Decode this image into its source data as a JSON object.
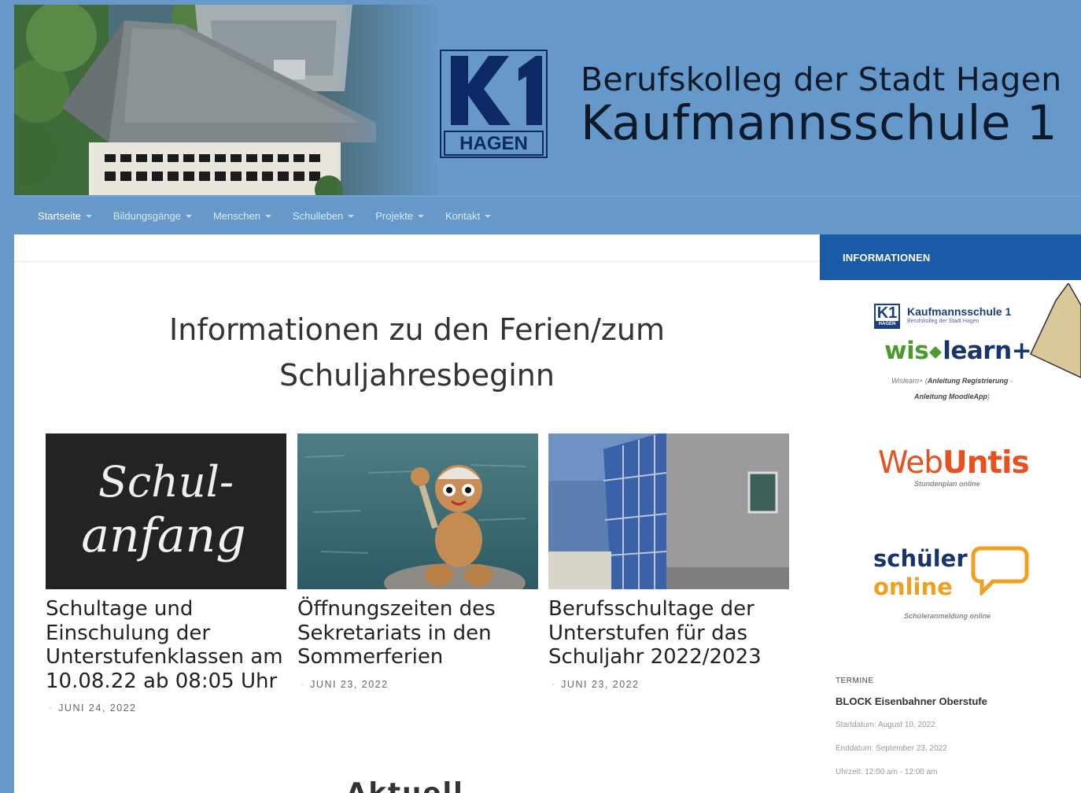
{
  "site": {
    "title_line1": "Berufskolleg der Stadt Hagen",
    "title_line2": "Kaufmannsschule 1",
    "logo_text_top": "K1",
    "logo_text_bottom": "HAGEN"
  },
  "nav": {
    "items": [
      {
        "label": "Startseite"
      },
      {
        "label": "Bildungsgänge"
      },
      {
        "label": "Menschen"
      },
      {
        "label": "Schulleben"
      },
      {
        "label": "Projekte"
      },
      {
        "label": "Kontakt"
      }
    ]
  },
  "main": {
    "section_title": "Informationen zu den Ferien/zum Schuljahresbeginn",
    "posts": [
      {
        "title": "Schultage und Einschulung der Unterstufenklassen am 10.08.22 ab 08:05 Uhr",
        "date": "JUNI 24, 2022",
        "image_text": "Schul-anfang"
      },
      {
        "title": "Öffnungszeiten des Sekretariats in den Sommerferien",
        "date": "JUNI 23, 2022"
      },
      {
        "title": "Berufsschultage der Unterstufen für das Schuljahr 2022/2023",
        "date": "JUNI 23, 2022"
      }
    ],
    "next_section_title": "Aktuell"
  },
  "sidebar": {
    "header": "INFORMATIONEN",
    "k1_name": "Kaufmannsschule 1",
    "k1_sub": "Berufskolleg der Stadt Hagen",
    "k1_box": "K1",
    "k1_box_small": "HAGEN",
    "wislearn_a": "wis",
    "wislearn_b": "learn+",
    "wislearn_note_a": "Wislearn+ (",
    "wislearn_note_b": "Anleitung Registrierung",
    "wislearn_note_c": " - ",
    "wislearn_note_d": "Anleitung MoodleApp",
    "wislearn_note_e": ")",
    "webuntis_a": "Web",
    "webuntis_b": "Untis",
    "webuntis_sub": "Stundenplan online",
    "schueler_1": "schüler",
    "schueler_2": "online",
    "schueler_sub": "Schüleranmeldung online",
    "termine_label": "TERMINE",
    "event": {
      "title": "BLOCK Eisenbahner Oberstufe",
      "start": "Startdatum: August 10, 2022",
      "end": "Enddatum: September 23, 2022",
      "time": "Uhrzeit: 12:00 am - 12:00 am"
    }
  },
  "colors": {
    "header_bg": "#6698c9",
    "sidebar_header_bg": "#1a5aa6",
    "webuntis_orange": "#e8501e",
    "wislearn_green": "#4a9a2e",
    "callout_fill": "#d8c89a"
  }
}
